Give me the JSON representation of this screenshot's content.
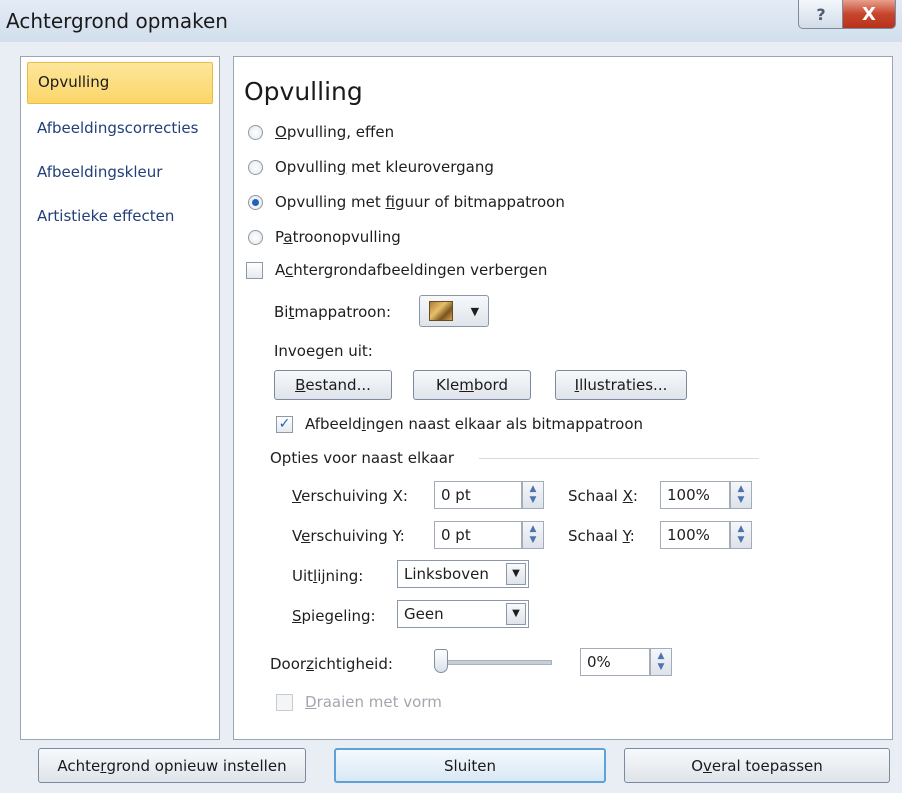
{
  "window": {
    "title": "Achtergrond opmaken",
    "help_glyph": "?",
    "close_glyph": "X"
  },
  "sidebar": {
    "items": [
      {
        "label": "Opvulling"
      },
      {
        "label": "Afbeeldingscorrecties"
      },
      {
        "label": "Afbeeldingskleur"
      },
      {
        "label": "Artistieke effecten"
      }
    ]
  },
  "content": {
    "heading": "Opvulling",
    "fill_options": [
      {
        "before": "",
        "key": "O",
        "after": "pvulling, effen",
        "checked": false
      },
      {
        "before": "Opvullin",
        "key": "g",
        "after": " met kleurovergang",
        "checked": false
      },
      {
        "before": "Opvulling met ",
        "key": "f",
        "after": "iguur of bitmappatroon",
        "checked": true
      },
      {
        "before": "P",
        "key": "a",
        "after": "troonopvulling",
        "checked": false
      }
    ],
    "hide_bg": {
      "before": "A",
      "key": "c",
      "after": "htergrondafbeeldingen verbergen"
    },
    "bitmap_label": {
      "before": "Bi",
      "key": "t",
      "after": "mappatroon:"
    },
    "dropdown_arrow": "▼",
    "insert_from": "Invoegen uit:",
    "buttons": {
      "file": {
        "before": "",
        "key": "B",
        "after": "estand..."
      },
      "clipboard": {
        "before": "Kle",
        "key": "m",
        "after": "bord"
      },
      "illustrations": {
        "before": "",
        "key": "I",
        "after": "llustraties..."
      }
    },
    "tile": {
      "before": "Afbeeld",
      "key": "i",
      "after": "ngen naast elkaar als bitmappatroon",
      "check": "✓"
    },
    "tile_group": "Opties voor naast elkaar",
    "offset_x": {
      "before": "",
      "key": "V",
      "after": "erschuiving X:",
      "value": "0 pt"
    },
    "offset_y": {
      "before": "V",
      "key": "e",
      "after": "rschuiving Y:",
      "value": "0 pt"
    },
    "scale_x": {
      "before": "Schaal ",
      "key": "X",
      "after": ":",
      "value": "100%"
    },
    "scale_y": {
      "before": "Schaal ",
      "key": "Y",
      "after": ":",
      "value": "100%"
    },
    "alignment": {
      "before": "Uit",
      "key": "l",
      "after": "ijning:",
      "value": "Linksboven"
    },
    "mirror": {
      "before": "",
      "key": "S",
      "after": "piegeling:",
      "value": "Geen"
    },
    "transparency": {
      "before": "Door",
      "key": "z",
      "after": "ichtigheid:",
      "value": "0%",
      "level": 0
    },
    "rotate": {
      "before": "",
      "key": "D",
      "after": "raaien met vorm"
    },
    "spin_up": "▲",
    "spin_down": "▼"
  },
  "footer": {
    "reset": {
      "before": "Achte",
      "key": "r",
      "after": "grond opnieuw instellen"
    },
    "close": "Sluiten",
    "apply_all": {
      "before": "O",
      "key": "v",
      "after": "eral toepassen"
    }
  }
}
